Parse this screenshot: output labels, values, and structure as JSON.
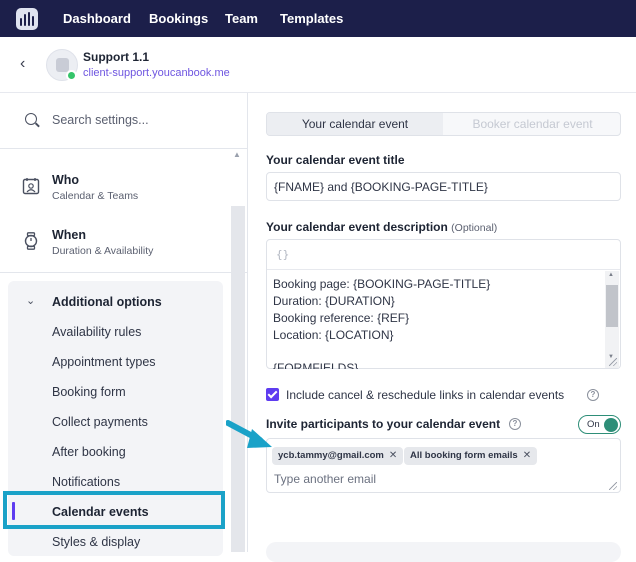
{
  "nav": {
    "items": [
      "Dashboard",
      "Bookings",
      "Team",
      "Templates"
    ]
  },
  "header": {
    "back_icon": "chevron-left-icon",
    "page_name": "Support 1.1",
    "page_url": "client-support.youcanbook.me"
  },
  "sidebar": {
    "search_placeholder": "Search settings...",
    "sections": [
      {
        "title": "Who",
        "subtitle": "Calendar & Teams",
        "icon": "calendar-team-icon"
      },
      {
        "title": "When",
        "subtitle": "Duration & Availability",
        "icon": "watch-icon"
      }
    ],
    "options_title": "Additional options",
    "options": [
      "Availability rules",
      "Appointment types",
      "Booking form",
      "Collect payments",
      "After booking",
      "Notifications",
      "Calendar events",
      "Styles & display"
    ],
    "active_option": "Calendar events"
  },
  "main": {
    "tabs": [
      "Your calendar event",
      "Booker calendar event"
    ],
    "title_label": "Your calendar event title",
    "title_value": "{FNAME} and {BOOKING-PAGE-TITLE}",
    "description_label": "Your calendar event description",
    "description_optional": "(Optional)",
    "description_toolbar": "{}",
    "description_lines": [
      "Booking page: {BOOKING-PAGE-TITLE}",
      "Duration: {DURATION}",
      "Booking reference: {REF}",
      "Location: {LOCATION}",
      "",
      "{FORMFIELDS}"
    ],
    "cancel_links_label": "Include cancel & reschedule links in calendar events",
    "cancel_links_checked": true,
    "invite_label": "Invite participants to your calendar event",
    "invite_toggle": "On",
    "invite_chips": [
      "ycb.tammy@gmail.com",
      "All booking form emails"
    ],
    "invite_placeholder": "Type another email"
  },
  "colors": {
    "nav_bg": "#1c1f4a",
    "accent": "#5e3cf0",
    "highlight": "#1aa2c8",
    "toggle": "#2e8e78"
  }
}
